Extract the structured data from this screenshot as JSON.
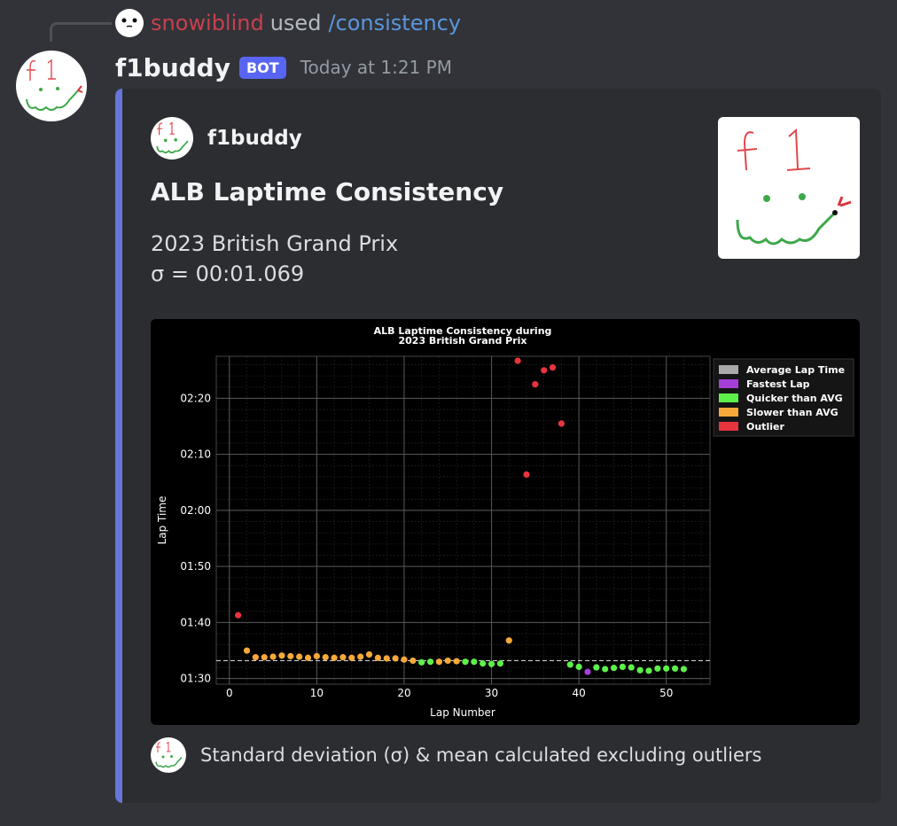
{
  "reply": {
    "username": "snowiblind",
    "used_text": "used",
    "command": "/consistency"
  },
  "message": {
    "author": "f1buddy",
    "bot_badge": "BOT",
    "timestamp": "Today at 1:21 PM"
  },
  "embed": {
    "author_name": "f1buddy",
    "title": "ALB Laptime Consistency",
    "description_line1": "2023 British Grand Prix",
    "description_line2": "σ = 00:01.069",
    "thumbnail_text": "f1",
    "footer_text": "Standard deviation (σ) & mean calculated excluding outliers"
  },
  "colors": {
    "average": "#aaaaaa",
    "fastest": "#a63fd8",
    "quicker": "#5ef04a",
    "slower": "#f7a93a",
    "outlier": "#e8343e"
  },
  "chart_data": {
    "type": "scatter",
    "title_line1": "ALB Laptime Consistency during",
    "title_line2": "2023 British Grand Prix",
    "xlabel": "Lap Number",
    "ylabel": "Lap Time",
    "xlim": [
      -1.5,
      55
    ],
    "ylim": [
      89,
      147.5
    ],
    "x_ticks": [
      0,
      10,
      20,
      30,
      40,
      50
    ],
    "y_ticks": [
      90,
      100,
      110,
      120,
      130,
      140
    ],
    "y_tick_labels": [
      "01:30",
      "01:40",
      "01:50",
      "02:00",
      "02:10",
      "02:20"
    ],
    "average_lap_time": 93.2,
    "grid": true,
    "legend_position": "top-right",
    "legend": [
      {
        "label": "Average Lap Time",
        "category": "average"
      },
      {
        "label": "Fastest Lap",
        "category": "fastest"
      },
      {
        "label": "Quicker than AVG",
        "category": "quicker"
      },
      {
        "label": "Slower than AVG",
        "category": "slower"
      },
      {
        "label": "Outlier",
        "category": "outlier"
      }
    ],
    "points": [
      {
        "lap": 1,
        "time": 101.3,
        "category": "outlier"
      },
      {
        "lap": 2,
        "time": 95.0,
        "category": "slower"
      },
      {
        "lap": 3,
        "time": 93.8,
        "category": "slower"
      },
      {
        "lap": 4,
        "time": 93.8,
        "category": "slower"
      },
      {
        "lap": 5,
        "time": 93.9,
        "category": "slower"
      },
      {
        "lap": 6,
        "time": 94.1,
        "category": "slower"
      },
      {
        "lap": 7,
        "time": 94.0,
        "category": "slower"
      },
      {
        "lap": 8,
        "time": 93.9,
        "category": "slower"
      },
      {
        "lap": 9,
        "time": 93.7,
        "category": "slower"
      },
      {
        "lap": 10,
        "time": 94.0,
        "category": "slower"
      },
      {
        "lap": 11,
        "time": 93.8,
        "category": "slower"
      },
      {
        "lap": 12,
        "time": 93.7,
        "category": "slower"
      },
      {
        "lap": 13,
        "time": 93.8,
        "category": "slower"
      },
      {
        "lap": 14,
        "time": 93.7,
        "category": "slower"
      },
      {
        "lap": 15,
        "time": 93.9,
        "category": "slower"
      },
      {
        "lap": 16,
        "time": 94.3,
        "category": "slower"
      },
      {
        "lap": 17,
        "time": 93.7,
        "category": "slower"
      },
      {
        "lap": 18,
        "time": 93.6,
        "category": "slower"
      },
      {
        "lap": 19,
        "time": 93.6,
        "category": "slower"
      },
      {
        "lap": 20,
        "time": 93.4,
        "category": "slower"
      },
      {
        "lap": 21,
        "time": 93.2,
        "category": "slower"
      },
      {
        "lap": 22,
        "time": 92.9,
        "category": "quicker"
      },
      {
        "lap": 23,
        "time": 93.0,
        "category": "quicker"
      },
      {
        "lap": 24,
        "time": 93.0,
        "category": "slower"
      },
      {
        "lap": 25,
        "time": 93.2,
        "category": "slower"
      },
      {
        "lap": 26,
        "time": 93.1,
        "category": "slower"
      },
      {
        "lap": 27,
        "time": 93.0,
        "category": "quicker"
      },
      {
        "lap": 28,
        "time": 93.0,
        "category": "quicker"
      },
      {
        "lap": 29,
        "time": 92.7,
        "category": "quicker"
      },
      {
        "lap": 30,
        "time": 92.6,
        "category": "quicker"
      },
      {
        "lap": 31,
        "time": 92.7,
        "category": "quicker"
      },
      {
        "lap": 32,
        "time": 96.8,
        "category": "slower"
      },
      {
        "lap": 33,
        "time": 146.7,
        "category": "outlier"
      },
      {
        "lap": 34,
        "time": 126.4,
        "category": "outlier"
      },
      {
        "lap": 35,
        "time": 142.5,
        "category": "outlier"
      },
      {
        "lap": 36,
        "time": 145.0,
        "category": "outlier"
      },
      {
        "lap": 37,
        "time": 145.5,
        "category": "outlier"
      },
      {
        "lap": 38,
        "time": 135.5,
        "category": "outlier"
      },
      {
        "lap": 39,
        "time": 92.5,
        "category": "quicker"
      },
      {
        "lap": 40,
        "time": 92.1,
        "category": "quicker"
      },
      {
        "lap": 41,
        "time": 91.2,
        "category": "fastest"
      },
      {
        "lap": 42,
        "time": 92.0,
        "category": "quicker"
      },
      {
        "lap": 43,
        "time": 91.7,
        "category": "quicker"
      },
      {
        "lap": 44,
        "time": 91.9,
        "category": "quicker"
      },
      {
        "lap": 45,
        "time": 92.1,
        "category": "quicker"
      },
      {
        "lap": 46,
        "time": 92.0,
        "category": "quicker"
      },
      {
        "lap": 47,
        "time": 91.5,
        "category": "quicker"
      },
      {
        "lap": 48,
        "time": 91.4,
        "category": "quicker"
      },
      {
        "lap": 49,
        "time": 91.8,
        "category": "quicker"
      },
      {
        "lap": 50,
        "time": 91.8,
        "category": "quicker"
      },
      {
        "lap": 51,
        "time": 91.8,
        "category": "quicker"
      },
      {
        "lap": 52,
        "time": 91.7,
        "category": "quicker"
      }
    ]
  }
}
